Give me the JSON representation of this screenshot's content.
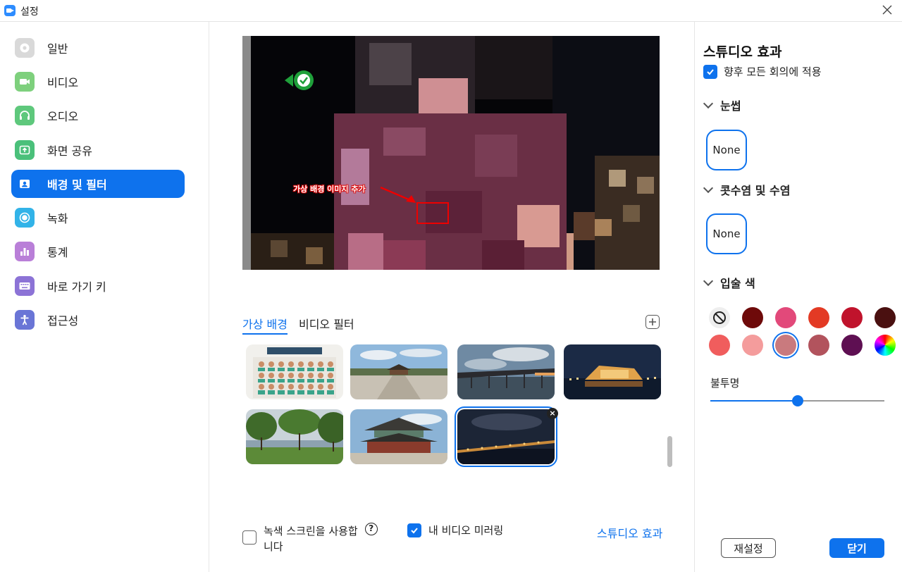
{
  "window": {
    "title": "설정"
  },
  "sidebar": {
    "items": [
      {
        "label": "일반",
        "icon": "gear-icon",
        "color": "#d9d9d9"
      },
      {
        "label": "비디오",
        "icon": "video-camera-icon",
        "color": "#7ed07d"
      },
      {
        "label": "오디오",
        "icon": "headphones-icon",
        "color": "#5ec87c"
      },
      {
        "label": "화면 공유",
        "icon": "screen-share-icon",
        "color": "#4ac07a"
      },
      {
        "label": "배경 및 필터",
        "icon": "portrait-icon",
        "color": "#0e72ed",
        "active": true
      },
      {
        "label": "녹화",
        "icon": "record-icon",
        "color": "#32b3e8"
      },
      {
        "label": "통계",
        "icon": "bar-chart-icon",
        "color": "#b97fd8"
      },
      {
        "label": "바로 가기 키",
        "icon": "keyboard-icon",
        "color": "#8c73d6"
      },
      {
        "label": "접근성",
        "icon": "accessibility-icon",
        "color": "#6a75d6"
      }
    ]
  },
  "preview": {
    "annotation": "가상 배경 이미지 추가"
  },
  "tabs": [
    {
      "label": "가상 배경",
      "active": true
    },
    {
      "label": "비디오 필터",
      "active": false
    }
  ],
  "backgrounds": [
    {
      "name": "classroom-grid"
    },
    {
      "name": "palace-courtyard"
    },
    {
      "name": "bridge-sunset"
    },
    {
      "name": "night-riverside-building"
    },
    {
      "name": "park-willows"
    },
    {
      "name": "palace-hall"
    },
    {
      "name": "night-bridge-lights",
      "selected": true
    }
  ],
  "bottom": {
    "green_screen_label_line1": "녹색 스크린을 사용합",
    "green_screen_label_line2": "니다",
    "green_screen_checked": false,
    "mirror_label": "내 비디오 미러링",
    "mirror_checked": true,
    "studio_link": "스튜디오 효과"
  },
  "panel": {
    "title": "스튜디오 효과",
    "apply_label": "향후 모든 회의에 적용",
    "apply_checked": true,
    "eyebrows_heading": "눈썹",
    "eyebrows_value": "None",
    "mustache_heading": "콧수염 및 수염",
    "mustache_value": "None",
    "lip_heading": "입술 색",
    "lip_colors": [
      "none",
      "#6e0a0a",
      "#e2497a",
      "#e33a24",
      "#c0132c",
      "#4a1010",
      "#f05d5d",
      "#f49c9c",
      "#c97a7e",
      "#b2535d",
      "#5e0f52",
      "rainbow"
    ],
    "lip_selected_index": 8,
    "opacity_label": "불투명",
    "opacity_value": 0.5,
    "reset_label": "재설정",
    "close_label": "닫기"
  }
}
